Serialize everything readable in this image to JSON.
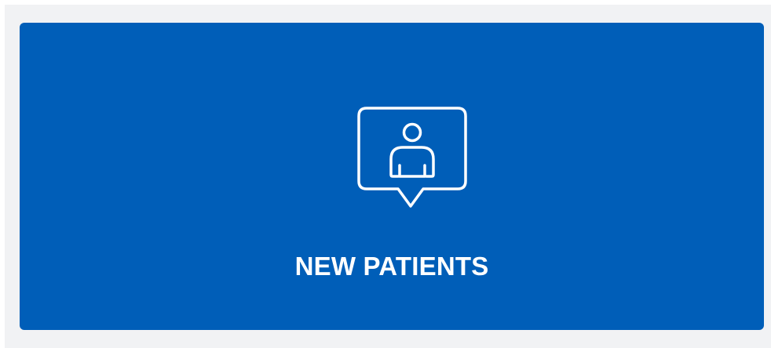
{
  "tile": {
    "label": "NEW PATIENTS",
    "icon": "person-speech-bubble-icon",
    "background_color": "#005eb8",
    "text_color": "#ffffff"
  },
  "page": {
    "background_color": "#f1f2f4"
  }
}
